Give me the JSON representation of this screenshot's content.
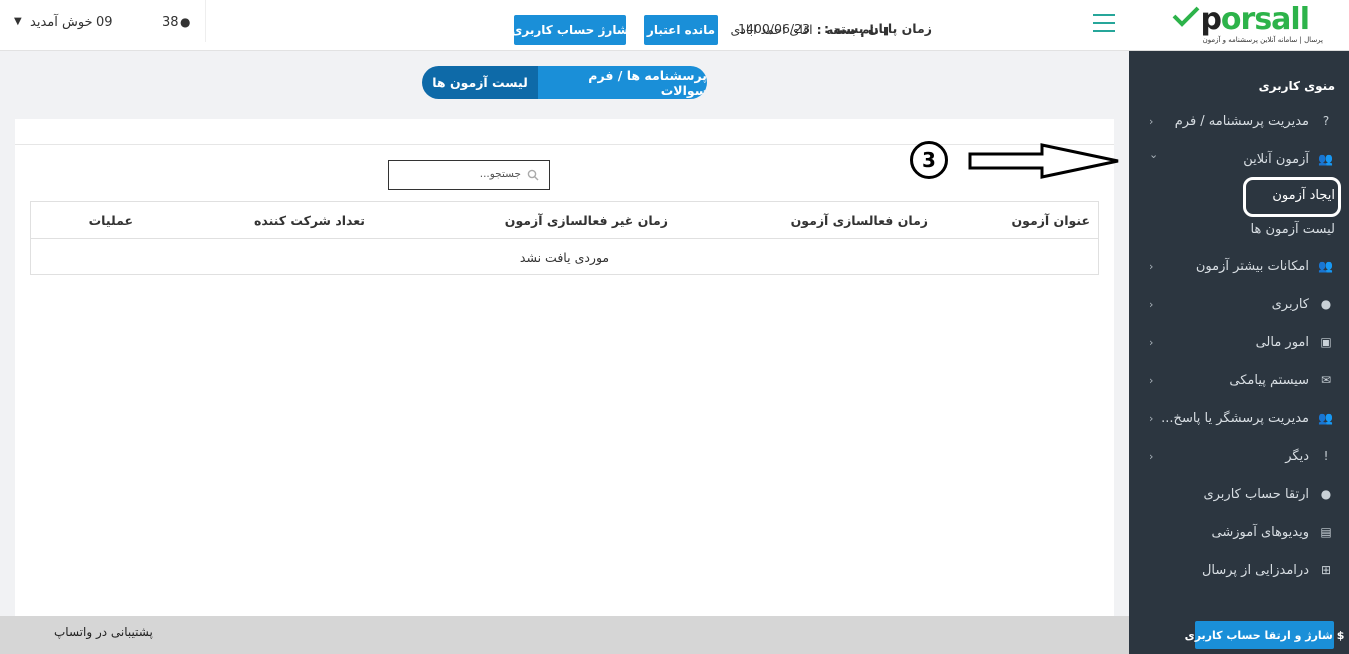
{
  "sidebar": {
    "logo": {
      "brand_dark": "p",
      "brand_green": "orsall",
      "tagline": "پرسال | سامانه آنلاین پرسشنامه و آزمون"
    },
    "menu_title": "منوی کاربری",
    "items": [
      {
        "label": "مدیریت پرسشنامه / فرم",
        "icon": "question-icon",
        "chevron": "‹"
      },
      {
        "label": "آزمون آنلاین",
        "icon": "users-icon",
        "chevron": "⌄"
      },
      {
        "label": "امکانات بیشتر آزمون",
        "icon": "users-icon",
        "chevron": "‹"
      },
      {
        "label": "کاربری",
        "icon": "user-icon",
        "chevron": "‹"
      },
      {
        "label": "امور مالی",
        "icon": "money-icon",
        "chevron": "‹"
      },
      {
        "label": "سیستم پیامکی",
        "icon": "envelope-icon",
        "chevron": "‹"
      },
      {
        "label": "مدیریت پرسشگر یا پاسخ...",
        "icon": "users-icon",
        "chevron": "‹"
      },
      {
        "label": "دیگر",
        "icon": "exclamation-icon",
        "chevron": "‹"
      },
      {
        "label": "ارتقا حساب کاربری",
        "icon": "user-icon"
      },
      {
        "label": "ویدیوهای آموزشی",
        "icon": "file-video-icon"
      },
      {
        "label": "درامدزایی از پرسال",
        "icon": "gift-icon"
      }
    ],
    "sub_items": [
      {
        "label": "ایجاد آزمون"
      },
      {
        "label": "لیست آزمون ها"
      }
    ]
  },
  "header": {
    "package_label": "نام بسته :",
    "package_value": "اقای احمد ابادی",
    "end_label": "زمان پایان بسته :",
    "end_value": "1400/06/23",
    "balance_button": "مانده اعتبار",
    "charge_button": "شارژ حساب کاربری",
    "user_greeting": "خوش آمدید",
    "user_left": "09",
    "user_count": "38"
  },
  "tabs": [
    {
      "label": "لیست آزمون ها",
      "active": true
    },
    {
      "label": "پرسشنامه ها / فرم سوالات",
      "active": false
    }
  ],
  "search": {
    "placeholder": "جستجو..."
  },
  "table": {
    "columns": [
      "عنوان آزمون",
      "زمان فعالسازی آزمون",
      "زمان غیر فعالسازی آزمون",
      "تعداد شرکت کننده",
      "عملیات"
    ],
    "empty_message": "موردی یافت نشد"
  },
  "annotation": {
    "step_number": "3"
  },
  "footer": {
    "support_text": "پشتیبانی در واتساپ",
    "upgrade_button": "$ شارژ و ارتقا حساب کاربری"
  },
  "colors": {
    "sidebar_bg": "#2c3640",
    "primary_blue": "#1a8fd8",
    "active_tab": "#0e6aa8",
    "hamburger_teal": "#26a69a",
    "brand_green": "#2db34a"
  }
}
